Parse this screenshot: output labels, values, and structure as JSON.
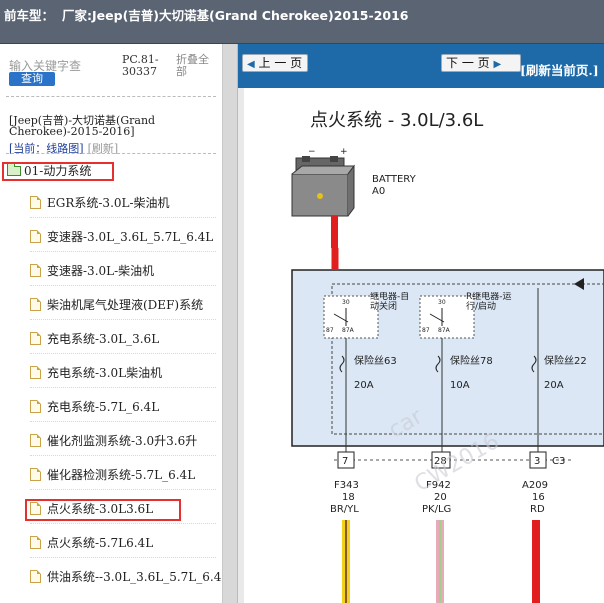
{
  "header": {
    "label": "前车型：",
    "title": "厂家:Jeep(吉普)大切诺基(Grand Cherokee)2015-2016"
  },
  "sidebar": {
    "search_hint": "输入关键字查",
    "search_button": "查询",
    "pc_code": "PC.81-30337",
    "collapse_all": "折叠全部",
    "vehicle": "[Jeep(吉普)-大切诺基(Grand Cherokee)-2015-2016]",
    "current_label": "[当前：",
    "current_value": "线路图]",
    "refresh": "[刷新]",
    "root": "01-动力系统",
    "items": [
      "EGR系统-3.0L-柴油机",
      "变速器-3.0L_3.6L_5.7L_6.4L",
      "变速器-3.0L-柴油机",
      "柴油机尾气处理液(DEF)系统",
      "充电系统-3.0L_3.6L",
      "充电系统-3.0L柴油机",
      "充电系统-5.7L_6.4L",
      "催化剂监测系统-3.0升3.6升",
      "催化器检测系统-5.7L_6.4L",
      "点火系统-3.0L3.6L",
      "点火系统-5.7L6.4L",
      "供油系统--3.0L_3.6L_5.7L_6.4L"
    ]
  },
  "viewer": {
    "prev_page": "上 一 页",
    "next_page": "下 一 页",
    "refresh_page": "[刷新当前页.]"
  },
  "diagram": {
    "title": "点火系统 - 3.0L/3.6L",
    "battery_label": "BATTERY",
    "battery_code": "A0",
    "relay1_label": "继电器-自动关闭",
    "relay2_label": "R继电器-运行/启动",
    "relay_pins": [
      "30",
      "87",
      "87A"
    ],
    "fuses": [
      {
        "label": "保险丝63",
        "amps": "20A"
      },
      {
        "label": "保险丝78",
        "amps": "10A"
      },
      {
        "label": "保险丝22",
        "amps": "20A"
      }
    ],
    "pins": [
      "7",
      "28",
      "3"
    ],
    "connector": "C3",
    "wires": [
      {
        "id": "F343",
        "gauge": "18",
        "color": "BR/YL"
      },
      {
        "id": "F942",
        "gauge": "20",
        "color": "PK/LG"
      },
      {
        "id": "A209",
        "gauge": "16",
        "color": "RD"
      }
    ],
    "watermark1": "car",
    "watermark2": "CW2016"
  }
}
